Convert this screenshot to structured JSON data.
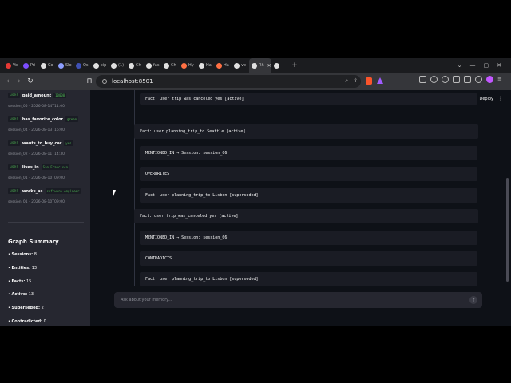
{
  "browser": {
    "tabs": [
      {
        "label": "Vo",
        "color": "#e53935"
      },
      {
        "label": "Pri",
        "color": "#7c4dff"
      },
      {
        "label": "Co",
        "color": "#e0e0e0"
      },
      {
        "label": "Slo",
        "color": "#8c9eff"
      },
      {
        "label": "Qs",
        "color": "#3f51b5"
      },
      {
        "label": "cip",
        "color": "#e0e0e0"
      },
      {
        "label": "(1)",
        "color": "#e0e0e0"
      },
      {
        "label": "Ch",
        "color": "#e0e0e0"
      },
      {
        "label": "fas",
        "color": "#e0e0e0"
      },
      {
        "label": "Ch",
        "color": "#e0e0e0"
      },
      {
        "label": "Hy",
        "color": "#ff7043"
      },
      {
        "label": "Ha",
        "color": "#e0e0e0"
      },
      {
        "label": "Ha",
        "color": "#ff7043"
      },
      {
        "label": "ve",
        "color": "#e0e0e0"
      },
      {
        "label": "Rh",
        "color": "#e0e0e0"
      },
      {
        "label": "",
        "color": "#e0e0e0"
      }
    ],
    "close_glyph": "✕",
    "new_tab_glyph": "+",
    "url": "localhost:8501"
  },
  "app": {
    "deploy_label": "Deploy",
    "menu_glyph": "⋮",
    "memories": [
      {
        "tag": "user",
        "key": "paid_amount",
        "value": "10000",
        "session": "session_05 - 2026-08-14T11:00"
      },
      {
        "tag": "user",
        "key": "has_favorite_color",
        "value": "green",
        "session": "session_04 - 2026-08-13T16:00"
      },
      {
        "tag": "user",
        "key": "wants_to_buy_car",
        "value": "yes",
        "session": "session_02 - 2026-08-11T14:30"
      },
      {
        "tag": "user",
        "key": "lives_in",
        "value": "San Francisco",
        "session": "session_01 - 2026-08-10T09:00"
      },
      {
        "tag": "user",
        "key": "works_as",
        "value": "software engineer",
        "session": "session_01 - 2026-08-10T09:00"
      }
    ],
    "graph_summary": {
      "title": "Graph Summary",
      "stats": [
        {
          "label": "Sessions:",
          "value": "8"
        },
        {
          "label": "Entities:",
          "value": "13"
        },
        {
          "label": "Facts:",
          "value": "15"
        },
        {
          "label": "Active:",
          "value": "13"
        },
        {
          "label": "Superseded:",
          "value": "2"
        },
        {
          "label": "Contradicted:",
          "value": "0"
        }
      ]
    },
    "graph_rows": [
      "Fact: user trip_was_canceled yes [active]",
      "Fact: user planning_trip_to Seattle [active]",
      "MENTIONED_IN → Session: session_06",
      "OVERWRITES",
      "Fact: user planning_trip_to Lisbon [superseded]",
      "Fact: user trip_was_canceled yes [active]",
      "MENTIONED_IN → Session: session_06",
      "CONTRADICTS",
      "Fact: user planning_trip_to Lisbon [superseded]"
    ],
    "chat_placeholder": "Ask about your memory...",
    "send_glyph": "↑"
  }
}
